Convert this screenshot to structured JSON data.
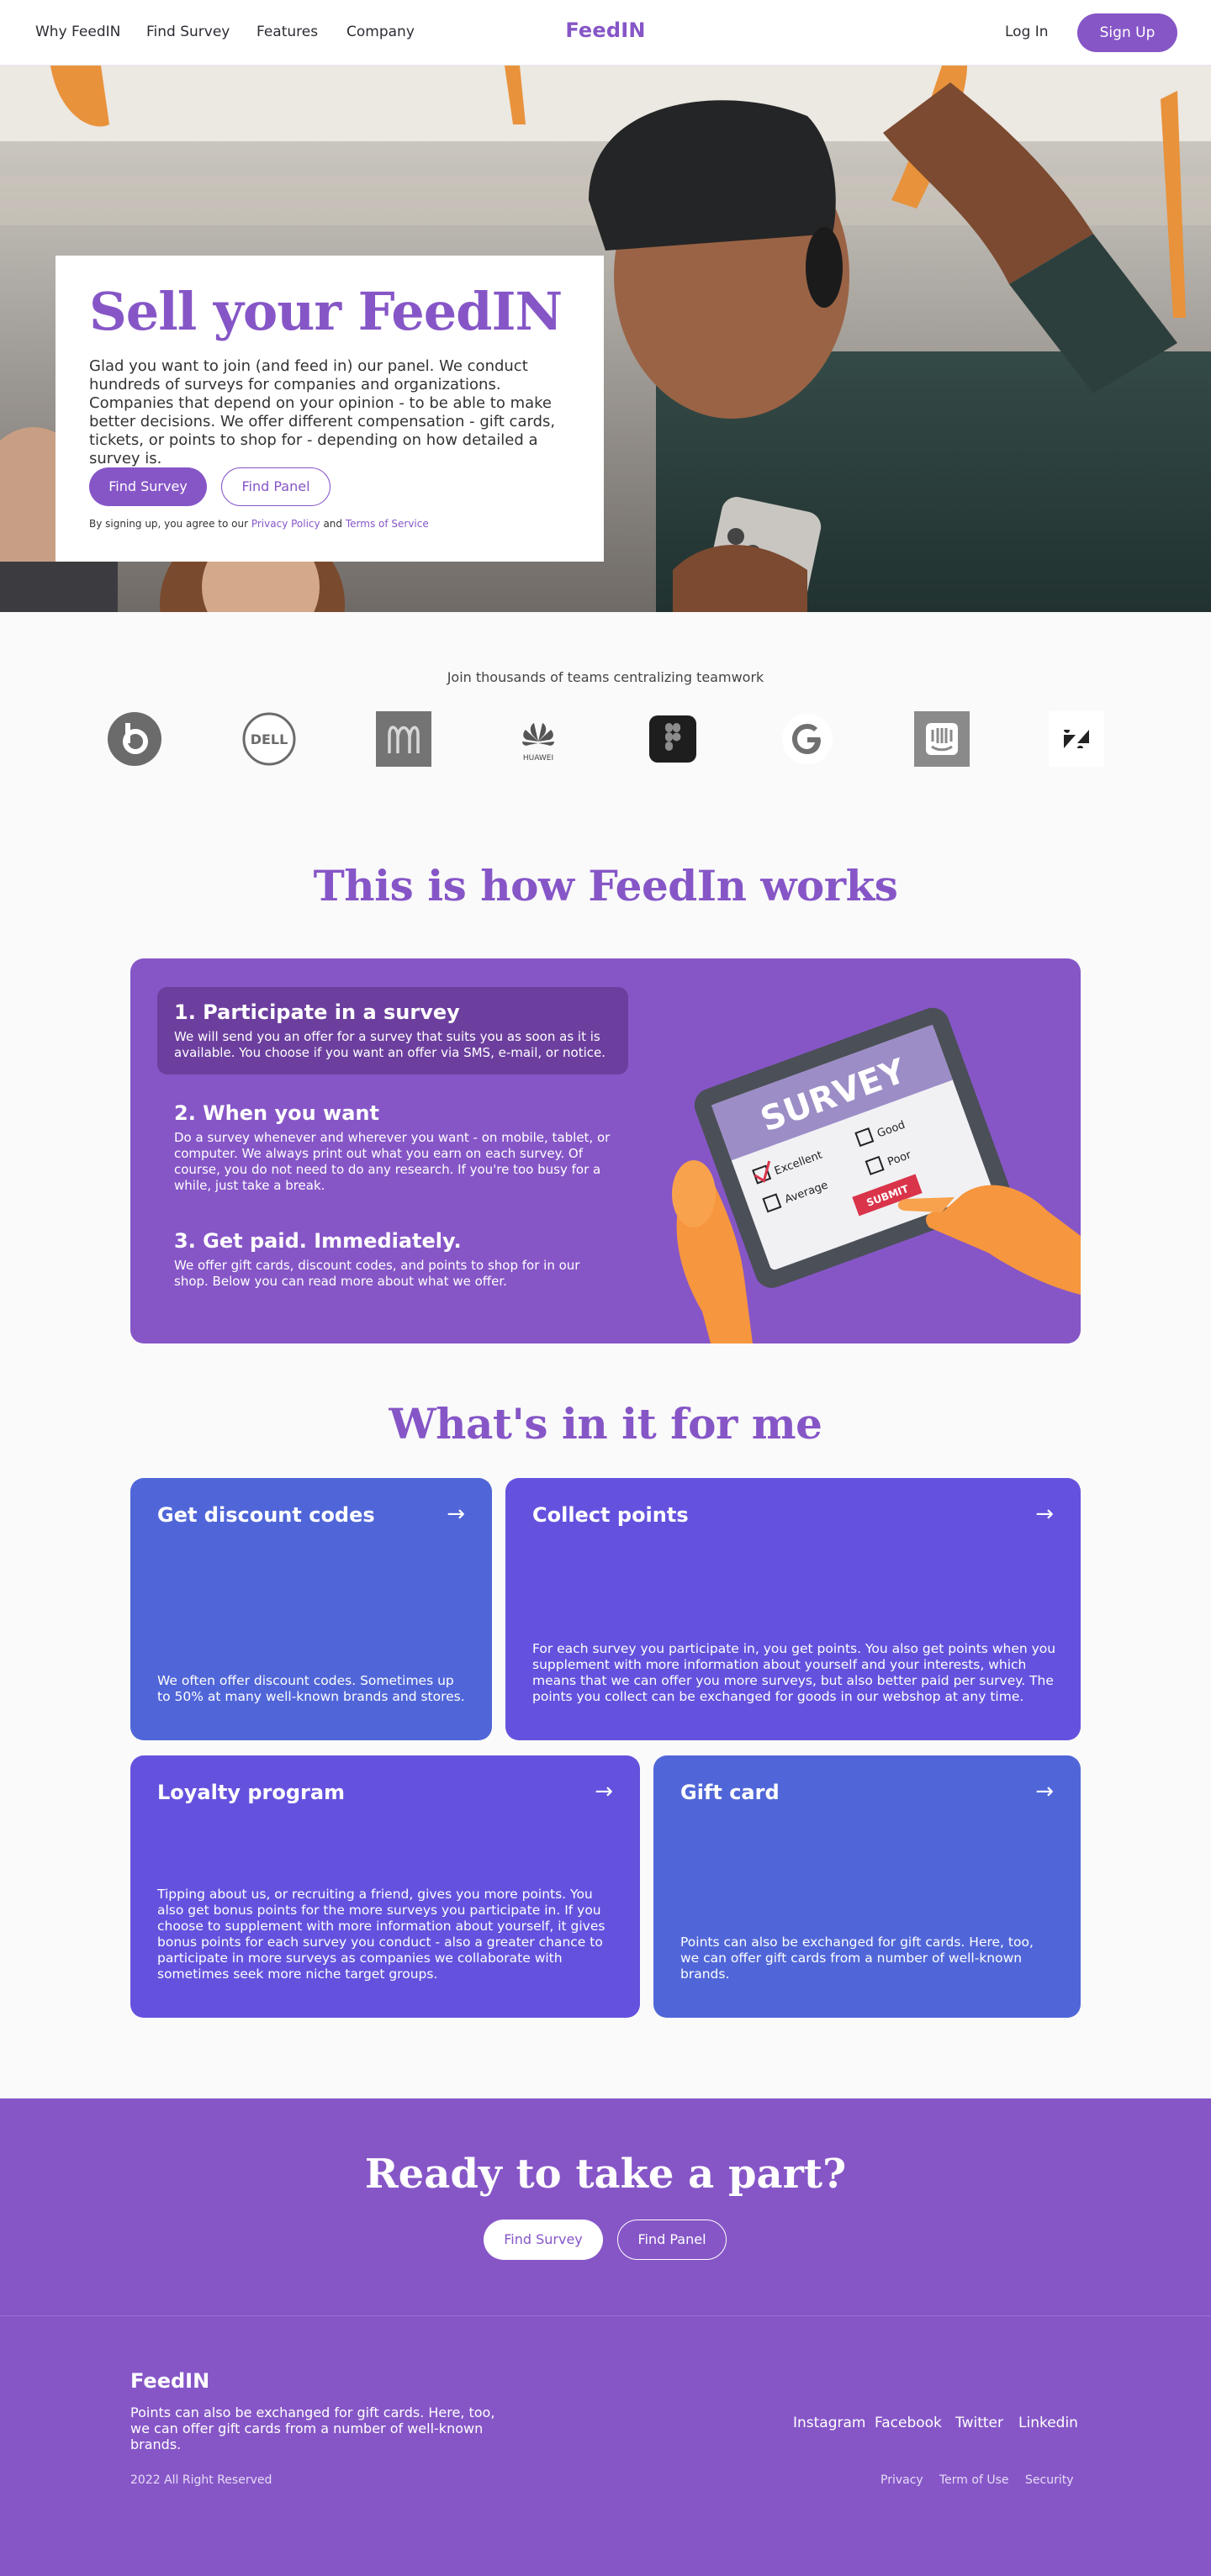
{
  "nav": {
    "links": [
      "Why FeedIN",
      "Find Survey",
      "Features",
      "Company"
    ],
    "brand": "FeedIN",
    "login": "Log In",
    "signup": "Sign Up"
  },
  "hero": {
    "title": "Sell your FeedIN",
    "text": "Glad you want to join (and feed in) our panel. We conduct hundreds of surveys for companies and organizations. Companies that depend on your opinion - to be able to make better decisions. We offer different compensation - gift cards, tickets, or points to shop for - depending on how detailed a survey is.",
    "primary_button": "Find Survey",
    "secondary_button": "Find Panel",
    "fine_prefix": "By signing up, you agree to our",
    "privacy_link": "Privacy Policy",
    "fine_and": "and",
    "terms_link": "Terms of Service"
  },
  "logos": {
    "caption": "Join thousands of teams centralizing teamwork",
    "items": [
      "beats-logo",
      "dell-logo",
      "mcdonalds-logo",
      "huawei-logo",
      "figma-logo",
      "google-logo",
      "intercom-logo",
      "zendesk-logo"
    ],
    "huawei_text": "HUAWEI",
    "dell_text": "DELL"
  },
  "how": {
    "title": "This is how FeedIn works",
    "steps": [
      {
        "title": "1. Participate in a survey",
        "text": "We will send you an offer for a survey that suits you as soon as it is available. You choose if you want an offer via SMS, e-mail, or notice."
      },
      {
        "title": "2. When you want",
        "text": "Do a survey whenever and wherever you want - on mobile, tablet, or computer. We always print out what you earn on each survey. Of course, you do not need to do any research. If you're too busy for a while, just take a break."
      },
      {
        "title": "3. Get paid. Immediately.",
        "text": "We offer gift cards, discount codes, and points to shop for in our shop. Below you can read more about what we offer."
      }
    ],
    "illustration": {
      "heading": "SURVEY",
      "options": [
        "Excellent",
        "Good",
        "Average",
        "Poor"
      ],
      "submit": "SUBMIT"
    }
  },
  "benefits": {
    "title": "What's in it for me",
    "cards": [
      {
        "title": "Get discount codes",
        "text": "We often offer discount codes. Sometimes up to 50% at many well-known brands and stores.",
        "arrow": "→"
      },
      {
        "title": "Collect points",
        "text": "For each survey you participate in, you get points. You also get points when you supplement with more information about yourself and your interests, which means that we can offer you more surveys, but also better paid per survey. The points you collect can be exchanged for goods in our webshop at any time.",
        "arrow": "→"
      },
      {
        "title": "Loyalty program",
        "text": "Tipping about us, or recruiting a friend, gives you more points. You also get bonus points for the more surveys you participate in. If you choose to supplement with more information about yourself, it gives bonus points for each survey you conduct - also a greater chance to participate in more surveys as companies we collaborate with sometimes seek more niche target groups.",
        "arrow": "→"
      },
      {
        "title": "Gift card",
        "text": "Points can also be exchanged for gift cards. Here, too, we can offer gift cards from a number of well-known brands.",
        "arrow": "→"
      }
    ],
    "colors": {
      "blue": "#5066d8",
      "violet": "#6452de"
    }
  },
  "cta": {
    "title": "Ready to take a part?",
    "primary_button": "Find Survey",
    "secondary_button": "Find Panel"
  },
  "footer": {
    "brand": "FeedIN",
    "text": "Points can also be exchanged for gift cards. Here, too, we can offer gift cards from a number of well-known brands.",
    "social": [
      "Instagram",
      "Facebook",
      "Twitter",
      "Linkedin"
    ],
    "copyright": "2022 All Right Reserved",
    "legal": [
      "Privacy",
      "Term of Use",
      "Security"
    ]
  },
  "colors": {
    "brand": "#8656c7",
    "brand_dark": "#6c3f9e"
  }
}
